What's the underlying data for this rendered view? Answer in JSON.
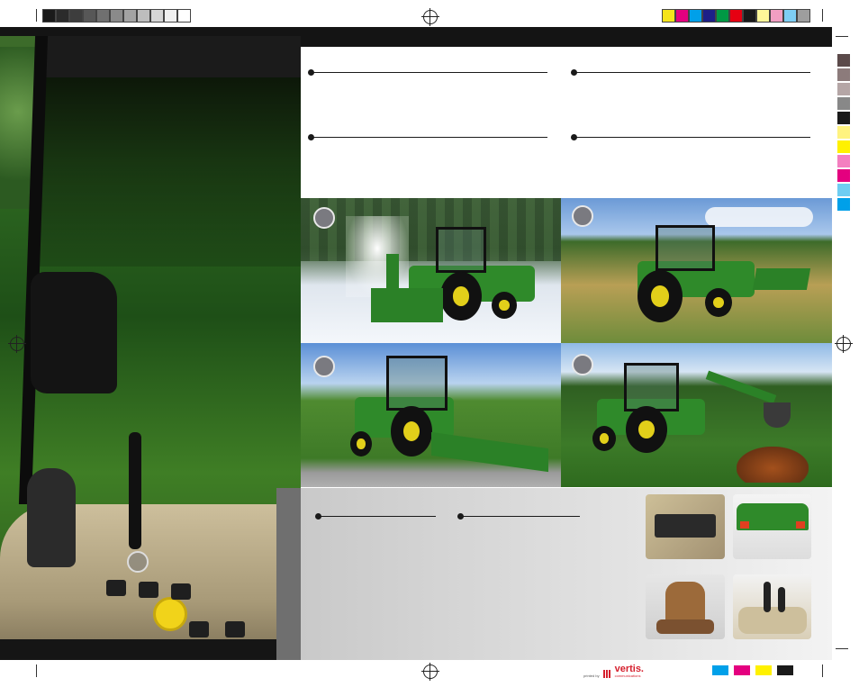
{
  "print_marks": {
    "grayscale": [
      "#1a1a1a",
      "#2b2b2b",
      "#3d3d3d",
      "#575757",
      "#707070",
      "#8a8a8a",
      "#a3a3a3",
      "#bdbdbd",
      "#d6d6d6",
      "#f0f0f0",
      "#ffffff"
    ],
    "process": [
      "#f5e41b",
      "#e4007f",
      "#00a0e9",
      "#1d2088",
      "#009944",
      "#e60012",
      "#1a1a1a",
      "#fff799",
      "#f19ec2",
      "#7ecef4",
      "#9e9e9e"
    ],
    "side_bars": [
      "#5b4a4a",
      "#8c7b7b",
      "#b5a6a6",
      "#888888",
      "#1a1a1a",
      "#fff380",
      "#fff100",
      "#f47fc0",
      "#e4007f",
      "#6fcdf2",
      "#00a0e9"
    ],
    "bottom_bars": [
      "#00a0e9",
      "#e4007f",
      "#fff100",
      "#1a1a1a"
    ]
  },
  "photos": {
    "markers": [
      "",
      "",
      "",
      ""
    ]
  },
  "footer": {
    "printer_prefix": "printed by",
    "printer_name": "vertis.",
    "printer_sub": "communications"
  },
  "colors": {
    "jd_green": "#2f8a2a",
    "jd_yellow": "#e2cf1a",
    "band": "#141414"
  }
}
